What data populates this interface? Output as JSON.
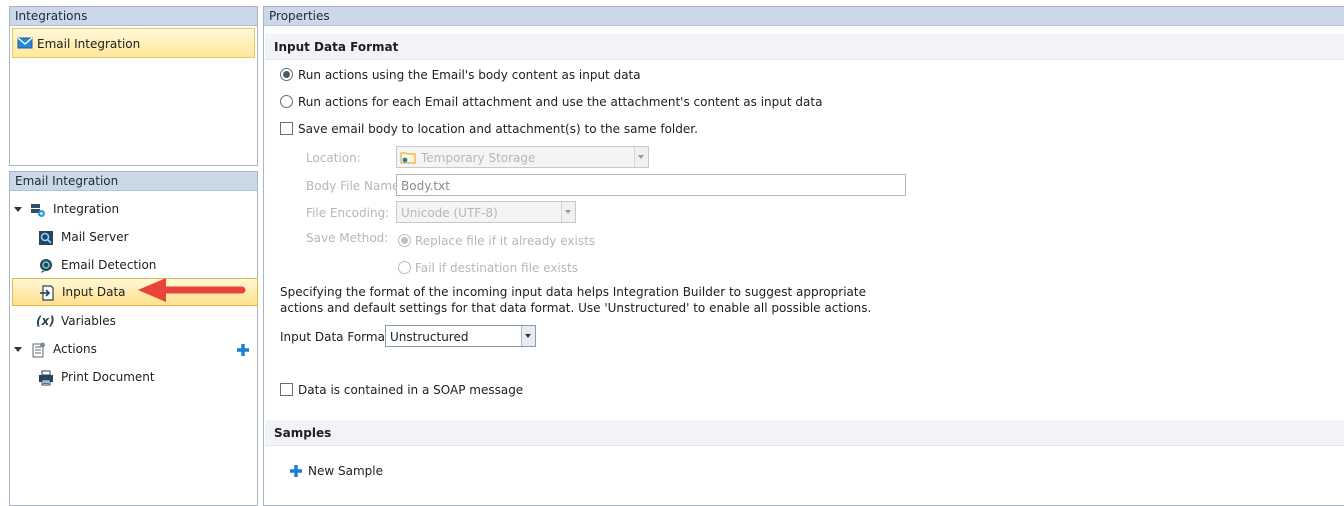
{
  "integrations_panel": {
    "header": "Integrations",
    "items": [
      {
        "label": "Email Integration",
        "icon": "envelope-icon"
      }
    ]
  },
  "tree_panel": {
    "header": "Email Integration",
    "items": [
      {
        "label": "Integration",
        "icon": "integration-icon"
      },
      {
        "label": "Mail Server",
        "icon": "mail-server-icon"
      },
      {
        "label": "Email Detection",
        "icon": "email-detection-icon"
      },
      {
        "label": "Input Data",
        "icon": "input-data-icon"
      },
      {
        "label": "Variables",
        "icon": "variables-icon"
      },
      {
        "label": "Actions",
        "icon": "actions-icon"
      },
      {
        "label": "Print Document",
        "icon": "printer-icon"
      }
    ],
    "variables_glyph": "(x)",
    "selected": "Input Data",
    "colors": {
      "annotation_arrow": "#e8443a",
      "add_icon": "#1a7fd1"
    }
  },
  "properties": {
    "header": "Properties",
    "input_data_format_section": {
      "title": "Input Data Format",
      "radio_body": "Run actions using the Email's body content as input data",
      "radio_attachment": "Run actions for each Email attachment and use the attachment's content as input data",
      "save_checkbox": "Save email body to location and attachment(s) to the same folder.",
      "location_label": "Location:",
      "location_value": "Temporary Storage",
      "body_file_label": "Body File Name:",
      "body_file_value": "Body.txt",
      "encoding_label": "File Encoding:",
      "encoding_value": "Unicode (UTF-8)",
      "save_method_label": "Save Method:",
      "save_method_replace": "Replace file if it already exists",
      "save_method_fail": "Fail if destination file exists",
      "description_line1": "Specifying the format of the incoming input data helps Integration Builder to suggest appropriate",
      "description_line2": "actions and default settings for that data format.  Use 'Unstructured' to enable all possible actions.",
      "format_label": "Input Data Format:",
      "format_value": "Unstructured",
      "soap_checkbox": "Data is contained in a SOAP message"
    },
    "samples_section": {
      "title": "Samples",
      "new_sample": "New Sample"
    }
  }
}
